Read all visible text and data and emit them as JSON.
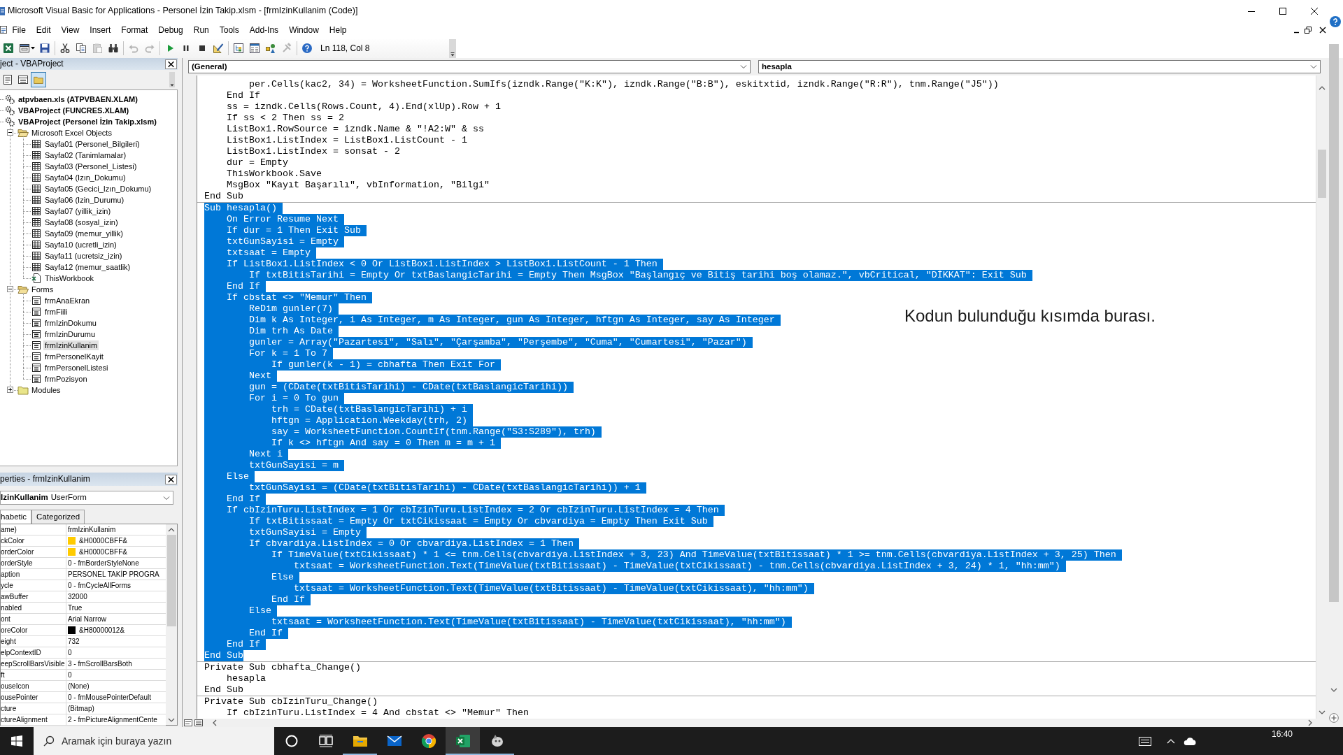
{
  "window": {
    "title": "Microsoft Visual Basic for Applications - Personel İzin Takip.xlsm - [frmIzinKullanim (Code)]"
  },
  "menu": [
    "File",
    "Edit",
    "View",
    "Insert",
    "Format",
    "Debug",
    "Run",
    "Tools",
    "Add-Ins",
    "Window",
    "Help"
  ],
  "toolbar": {
    "groups": [
      [
        {
          "kind": "excel",
          "disabled": false
        },
        {
          "kind": "form",
          "disabled": false
        },
        {
          "kind": "dropdown",
          "disabled": false
        },
        {
          "kind": "save",
          "disabled": false
        }
      ],
      [
        {
          "kind": "cut",
          "disabled": false
        },
        {
          "kind": "copy",
          "disabled": false
        },
        {
          "kind": "paste",
          "disabled": true
        },
        {
          "kind": "find",
          "disabled": false
        }
      ],
      [
        {
          "kind": "undo",
          "disabled": true
        },
        {
          "kind": "redo",
          "disabled": true
        }
      ],
      [
        {
          "kind": "run",
          "disabled": false
        },
        {
          "kind": "pause",
          "disabled": false
        },
        {
          "kind": "reset",
          "disabled": false
        },
        {
          "kind": "design",
          "disabled": false
        }
      ],
      [
        {
          "kind": "explorer",
          "disabled": false
        },
        {
          "kind": "properties",
          "disabled": false
        },
        {
          "kind": "browser",
          "disabled": false
        },
        {
          "kind": "toolbox",
          "disabled": true
        }
      ],
      [
        {
          "kind": "help",
          "disabled": false
        }
      ]
    ],
    "position": "Ln 118, Col 8"
  },
  "project_explorer": {
    "title": "ject - VBAProject",
    "toolbar": [
      {
        "kind": "code",
        "on": false
      },
      {
        "kind": "object",
        "on": false
      },
      {
        "kind": "folders",
        "on": true
      }
    ],
    "tree": [
      {
        "label": "atpvbaen.xls (ATPVBAEN.XLAM)",
        "kind": "project",
        "selected": false
      },
      {
        "label": "VBAProject (FUNCRES.XLAM)",
        "kind": "project",
        "selected": false
      },
      {
        "label": "VBAProject (Personel İzin Takip.xlsm)",
        "kind": "project",
        "selected": false,
        "children": [
          {
            "label": "Microsoft Excel Objects",
            "kind": "folder",
            "expanded": true,
            "selected": false,
            "children": [
              {
                "label": "Sayfa01 (Personel_Bilgileri)",
                "kind": "sheet",
                "selected": false
              },
              {
                "label": "Sayfa02 (Tanimlamalar)",
                "kind": "sheet",
                "selected": false
              },
              {
                "label": "Sayfa03 (Personel_Listesi)",
                "kind": "sheet",
                "selected": false
              },
              {
                "label": "Sayfa04 (Izın_Dokumu)",
                "kind": "sheet",
                "selected": false
              },
              {
                "label": "Sayfa05 (Gecici_Izın_Dokumu)",
                "kind": "sheet",
                "selected": false
              },
              {
                "label": "Sayfa06 (Izin_Durumu)",
                "kind": "sheet",
                "selected": false
              },
              {
                "label": "Sayfa07 (yillik_izin)",
                "kind": "sheet",
                "selected": false
              },
              {
                "label": "Sayfa08 (sosyal_izin)",
                "kind": "sheet",
                "selected": false
              },
              {
                "label": "Sayfa09 (memur_yillik)",
                "kind": "sheet",
                "selected": false
              },
              {
                "label": "Sayfa10 (ucretli_izin)",
                "kind": "sheet",
                "selected": false
              },
              {
                "label": "Sayfa11 (ucretsiz_izin)",
                "kind": "sheet",
                "selected": false
              },
              {
                "label": "Sayfa12 (memur_saatlik)",
                "kind": "sheet",
                "selected": false
              },
              {
                "label": "ThisWorkbook",
                "kind": "workbook",
                "selected": false
              }
            ]
          },
          {
            "label": "Forms",
            "kind": "folder",
            "expanded": true,
            "selected": false,
            "children": [
              {
                "label": "frmAnaEkran",
                "kind": "form",
                "selected": false
              },
              {
                "label": "frmFiili",
                "kind": "form",
                "selected": false
              },
              {
                "label": "frmIzinDokumu",
                "kind": "form",
                "selected": false
              },
              {
                "label": "frmIzinDurumu",
                "kind": "form",
                "selected": false
              },
              {
                "label": "frmIzinKullanim",
                "kind": "form",
                "selected": true
              },
              {
                "label": "frmPersonelKayit",
                "kind": "form",
                "selected": false
              },
              {
                "label": "frmPersonelListesi",
                "kind": "form",
                "selected": false
              },
              {
                "label": "frmPozisyon",
                "kind": "form",
                "selected": false
              }
            ]
          },
          {
            "label": "Modules",
            "kind": "folder",
            "expanded": false,
            "selected": false
          }
        ]
      }
    ]
  },
  "properties": {
    "title": "perties - frmIzinKullanim",
    "object": {
      "name": "IzinKullanim",
      "type": "UserForm"
    },
    "tabs": [
      {
        "label": "habetic",
        "selected": true
      },
      {
        "label": "Categorized",
        "selected": false
      }
    ],
    "rows": [
      {
        "name": "ame)",
        "value": "frmIzinKullanim"
      },
      {
        "name": "ckColor",
        "value": "&H0000CBFF&",
        "color": "#ffcb00"
      },
      {
        "name": "orderColor",
        "value": "&H0000CBFF&",
        "color": "#ffcb00"
      },
      {
        "name": "orderStyle",
        "value": "0 - fmBorderStyleNone"
      },
      {
        "name": "aption",
        "value": "PERSONEL TAKİP PROGRA"
      },
      {
        "name": "ycle",
        "value": "0 - fmCycleAllForms"
      },
      {
        "name": "awBuffer",
        "value": "32000"
      },
      {
        "name": "nabled",
        "value": "True"
      },
      {
        "name": "ont",
        "value": "Arial Narrow"
      },
      {
        "name": "oreColor",
        "value": "&H80000012&",
        "color": "#000000"
      },
      {
        "name": "eight",
        "value": "732"
      },
      {
        "name": "elpContextID",
        "value": "0"
      },
      {
        "name": "eepScrollBarsVisible",
        "value": "3 - fmScrollBarsBoth"
      },
      {
        "name": "ft",
        "value": "0"
      },
      {
        "name": "ouseIcon",
        "value": "(None)"
      },
      {
        "name": "ousePointer",
        "value": "0 - fmMousePointerDefault"
      },
      {
        "name": "cture",
        "value": "(Bitmap)"
      },
      {
        "name": "ctureAlignment",
        "value": "2 - fmPictureAlignmentCente"
      }
    ]
  },
  "code_window": {
    "object_list": "(General)",
    "procedure_list": "hesapla",
    "procedures": [
      {
        "lines": [
          {
            "text": "        per.Cells(kac2, 34) = WorksheetFunction.SumIfs(izndk.Range(\"K:K\"), izndk.Range(\"B:B\"), eskitxtid, izndk.Range(\"R:R\"), tnm.Range(\"J5\"))",
            "selected": false
          },
          {
            "text": "    End If",
            "selected": false
          },
          {
            "text": "    ss = izndk.Cells(Rows.Count, 4).End(xlUp).Row + 1",
            "selected": false
          },
          {
            "text": "    If ss < 2 Then ss = 2",
            "selected": false
          },
          {
            "text": "    ListBox1.RowSource = izndk.Name & \"!A2:W\" & ss",
            "selected": false
          },
          {
            "text": "    ListBox1.ListIndex = ListBox1.ListCount - 1",
            "selected": false
          },
          {
            "text": "    ListBox1.ListIndex = sonsat - 2",
            "selected": false
          },
          {
            "text": "    dur = Empty",
            "selected": false
          },
          {
            "text": "    ThisWorkbook.Save",
            "selected": false
          },
          {
            "text": "    MsgBox \"Kayıt Başarılı\", vbInformation, \"Bilgi\"",
            "selected": false
          },
          {
            "text": "End Sub",
            "selected": false
          }
        ]
      },
      {
        "lines": [
          {
            "text": "Sub hesapla()",
            "selected": true
          },
          {
            "text": "    On Error Resume Next",
            "selected": true
          },
          {
            "text": "    If dur = 1 Then Exit Sub",
            "selected": true
          },
          {
            "text": "    txtGunSayisi = Empty",
            "selected": true
          },
          {
            "text": "    txtsaat = Empty",
            "selected": true
          },
          {
            "text": "    If ListBox1.ListIndex < 0 Or ListBox1.ListIndex > ListBox1.ListCount - 1 Then",
            "selected": true
          },
          {
            "text": "        If txtBitisTarihi = Empty Or txtBaslangicTarihi = Empty Then MsgBox \"Başlangıç ve Bitiş tarihi boş olamaz.\", vbCritical, \"DİKKAT\": Exit Sub",
            "selected": true
          },
          {
            "text": "    End If",
            "selected": true
          },
          {
            "text": "    If cbstat <> \"Memur\" Then",
            "selected": true
          },
          {
            "text": "        ReDim gunler(7)",
            "selected": true
          },
          {
            "text": "        Dim k As Integer, i As Integer, m As Integer, gun As Integer, hftgn As Integer, say As Integer",
            "selected": true
          },
          {
            "text": "        Dim trh As Date",
            "selected": true
          },
          {
            "text": "        gunler = Array(\"Pazartesi\", \"Salı\", \"Çarşamba\", \"Perşembe\", \"Cuma\", \"Cumartesi\", \"Pazar\")",
            "selected": true
          },
          {
            "text": "        For k = 1 To 7",
            "selected": true
          },
          {
            "text": "            If gunler(k - 1) = cbhafta Then Exit For",
            "selected": true
          },
          {
            "text": "        Next",
            "selected": true
          },
          {
            "text": "        gun = (CDate(txtBitisTarihi) - CDate(txtBaslangicTarihi))",
            "selected": true
          },
          {
            "text": "        For i = 0 To gun",
            "selected": true
          },
          {
            "text": "            trh = CDate(txtBaslangicTarihi) + i",
            "selected": true
          },
          {
            "text": "            hftgn = Application.Weekday(trh, 2)",
            "selected": true
          },
          {
            "text": "            say = WorksheetFunction.CountIf(tnm.Range(\"S3:S289\"), trh)",
            "selected": true
          },
          {
            "text": "            If k <> hftgn And say = 0 Then m = m + 1",
            "selected": true
          },
          {
            "text": "        Next i",
            "selected": true
          },
          {
            "text": "        txtGunSayisi = m",
            "selected": true
          },
          {
            "text": "    Else",
            "selected": true
          },
          {
            "text": "        txtGunSayisi = (CDate(txtBitisTarihi) - CDate(txtBaslangicTarihi)) + 1",
            "selected": true
          },
          {
            "text": "    End If",
            "selected": true
          },
          {
            "text": "    If cbIzinTuru.ListIndex = 1 Or cbIzinTuru.ListIndex = 2 Or cbIzinTuru.ListIndex = 4 Then",
            "selected": true
          },
          {
            "text": "        If txtBitissaat = Empty Or txtCikissaat = Empty Or cbvardiya = Empty Then Exit Sub",
            "selected": true
          },
          {
            "text": "        txtGunSayisi = Empty",
            "selected": true
          },
          {
            "text": "        If cbvardiya.ListIndex = 0 Or cbvardiya.ListIndex = 1 Then",
            "selected": true
          },
          {
            "text": "            If TimeValue(txtCikissaat) * 1 <= tnm.Cells(cbvardiya.ListIndex + 3, 23) And TimeValue(txtBitissaat) * 1 >= tnm.Cells(cbvardiya.ListIndex + 3, 25) Then",
            "selected": true
          },
          {
            "text": "                txtsaat = WorksheetFunction.Text(TimeValue(txtBitissaat) - TimeValue(txtCikissaat) - tnm.Cells(cbvardiya.ListIndex + 3, 24) * 1, \"hh:mm\")",
            "selected": true
          },
          {
            "text": "            Else",
            "selected": true
          },
          {
            "text": "                txtsaat = WorksheetFunction.Text(TimeValue(txtBitissaat) - TimeValue(txtCikissaat), \"hh:mm\")",
            "selected": true
          },
          {
            "text": "            End If",
            "selected": true
          },
          {
            "text": "        Else",
            "selected": true
          },
          {
            "text": "            txtsaat = WorksheetFunction.Text(TimeValue(txtBitissaat) - TimeValue(txtCikissaat), \"hh:mm\")",
            "selected": true
          },
          {
            "text": "        End If",
            "selected": true
          },
          {
            "text": "    End If",
            "selected": true
          },
          {
            "text": "End Sub",
            "selected": true
          }
        ]
      },
      {
        "lines": [
          {
            "text": "Private Sub cbhafta_Change()",
            "selected": false
          },
          {
            "text": "    hesapla",
            "selected": false
          },
          {
            "text": "End Sub",
            "selected": false
          }
        ]
      },
      {
        "lines": [
          {
            "text": "Private Sub cbIzinTuru_Change()",
            "selected": false
          },
          {
            "text": "    If cbIzinTuru.ListIndex = 4 And cbstat <> \"Memur\" Then",
            "selected": false
          }
        ]
      }
    ],
    "annotation": "Kodun bulunduğu kısımda burası."
  },
  "taskbar": {
    "search": {
      "placeholder": "Aramak için buraya yazın"
    },
    "apps": [
      {
        "kind": "cortana",
        "open": false,
        "selected": false
      },
      {
        "kind": "taskview",
        "open": false,
        "selected": false
      },
      {
        "kind": "explorer",
        "open": true,
        "selected": false
      },
      {
        "kind": "mail",
        "open": false,
        "selected": false
      },
      {
        "kind": "browser",
        "open": false,
        "selected": false
      },
      {
        "kind": "excel",
        "open": true,
        "selected": true
      },
      {
        "kind": "app",
        "open": true,
        "selected": false
      }
    ],
    "time": "16:40"
  }
}
